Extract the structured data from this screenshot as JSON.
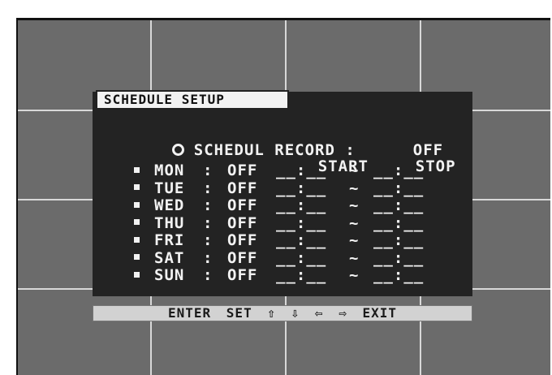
{
  "menu": {
    "title": "SCHEDULE SETUP",
    "schedule_record": {
      "label": "SCHEDUL RECORD :",
      "value": "OFF"
    },
    "headers": {
      "start": "START",
      "stop": "STOP"
    },
    "days": [
      {
        "day": "MON",
        "status": "OFF",
        "start": "__:__",
        "sep": "~",
        "stop": "__:__"
      },
      {
        "day": "TUE",
        "status": "OFF",
        "start": "__:__",
        "sep": "~",
        "stop": "__:__"
      },
      {
        "day": "WED",
        "status": "OFF",
        "start": "__:__",
        "sep": "~",
        "stop": "__:__"
      },
      {
        "day": "THU",
        "status": "OFF",
        "start": "__:__",
        "sep": "~",
        "stop": "__:__"
      },
      {
        "day": "FRI",
        "status": "OFF",
        "start": "__:__",
        "sep": "~",
        "stop": "__:__"
      },
      {
        "day": "SAT",
        "status": "OFF",
        "start": "__:__",
        "sep": "~",
        "stop": "__:__"
      },
      {
        "day": "SUN",
        "status": "OFF",
        "start": "__:__",
        "sep": "~",
        "stop": "__:__"
      }
    ],
    "footer": {
      "enter": "ENTER",
      "set": "SET",
      "up": "⇧",
      "down": "⇩",
      "left": "⇦",
      "right": "⇨",
      "exit": "EXIT"
    }
  }
}
